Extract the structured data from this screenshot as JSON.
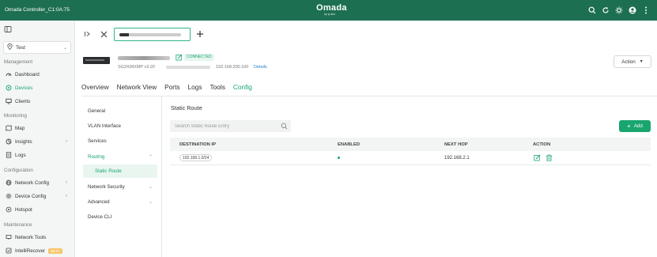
{
  "app": {
    "controller_title": "Omada Controller_C1:0A:75",
    "brand": "Omada",
    "brand_sub": "by tp-link"
  },
  "topbar_icons": [
    "search-icon",
    "refresh-icon",
    "theme-icon",
    "avatar",
    "more-icon"
  ],
  "sidebar": {
    "site": "Test",
    "sections": {
      "management": "Management",
      "monitoring": "Monitoring",
      "configuration": "Configuration",
      "maintenance": "Maintenance"
    },
    "items": {
      "dashboard": "Dashboard",
      "devices": "Devices",
      "clients": "Clients",
      "map": "Map",
      "insights": "Insights",
      "logs": "Logs",
      "network_config": "Network Config",
      "device_config": "Device Config",
      "hotspot": "Hotspot",
      "network_tools": "Network Tools",
      "intellirecover": "IntelliRecover",
      "beta": "BETA"
    }
  },
  "device": {
    "status": "CONNECTED",
    "model": "SG2428XMP v3.20",
    "ip": "192.168.200.100",
    "details_link": "Details",
    "action_label": "Action"
  },
  "main_tabs": [
    "Overview",
    "Network View",
    "Ports",
    "Logs",
    "Tools",
    "Config"
  ],
  "active_tab": "Config",
  "config_menu": {
    "general": "General",
    "vlan_interface": "VLAN Interface",
    "services": "Services",
    "routing": "Routing",
    "static_route": "Static Route",
    "network_security": "Network Security",
    "advanced": "Advanced",
    "device_cli": "Device CLI"
  },
  "content": {
    "title": "Static Route",
    "search_placeholder": "Search Static Route Entry",
    "add_label": "Add",
    "columns": {
      "destination_ip": "DESTINATION IP",
      "enabled": "ENABLED",
      "next_hop": "NEXT HOP",
      "action": "ACTION"
    },
    "rows": [
      {
        "destination_ip": "192.168.1.0/24",
        "enabled": true,
        "next_hop": "192.168.2.1"
      }
    ]
  },
  "colors": {
    "topbar": "#1d6f52",
    "accent": "#17a571",
    "add_button": "#18a56e"
  }
}
